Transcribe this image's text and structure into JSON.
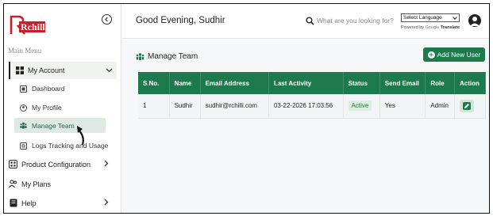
{
  "sidebar": {
    "logo_text": "Rchilli",
    "main_menu_label": "Main Menu",
    "items": [
      {
        "label": "My Account",
        "icon": "grid-icon"
      },
      {
        "label": "Dashboard",
        "icon": "dashboard-icon"
      },
      {
        "label": "My Profile",
        "icon": "profile-icon"
      },
      {
        "label": "Manage Team",
        "icon": "team-icon"
      },
      {
        "label": "Logs Tracking and Usage",
        "icon": "logs-icon"
      },
      {
        "label": "Product Configuration",
        "icon": "config-icon"
      },
      {
        "label": "My Plans",
        "icon": "users-icon"
      },
      {
        "label": "Help",
        "icon": "help-icon"
      }
    ]
  },
  "header": {
    "greeting": "Good Evening, Sudhir",
    "search_placeholder": "What are you looking for?",
    "language_select": "Select Language",
    "powered_by": "Powered by",
    "google_label": "Google",
    "translate_label": "Translate"
  },
  "main": {
    "title": "Manage Team",
    "add_user_label": "Add New User",
    "table": {
      "columns": [
        "S.No.",
        "Name",
        "Email Address",
        "Last Activity",
        "Status",
        "Send Email",
        "Role",
        "Action"
      ],
      "rows": [
        {
          "sno": "1",
          "name": "Sudhir",
          "email": "sudhir@rchilli.com",
          "last_activity": "03-22-2026 17:03:56",
          "status": "Active",
          "send_email": "Yes",
          "role": "Admin"
        }
      ]
    }
  },
  "colors": {
    "accent": "#1d7a4c",
    "brand_red": "#c8202a"
  }
}
